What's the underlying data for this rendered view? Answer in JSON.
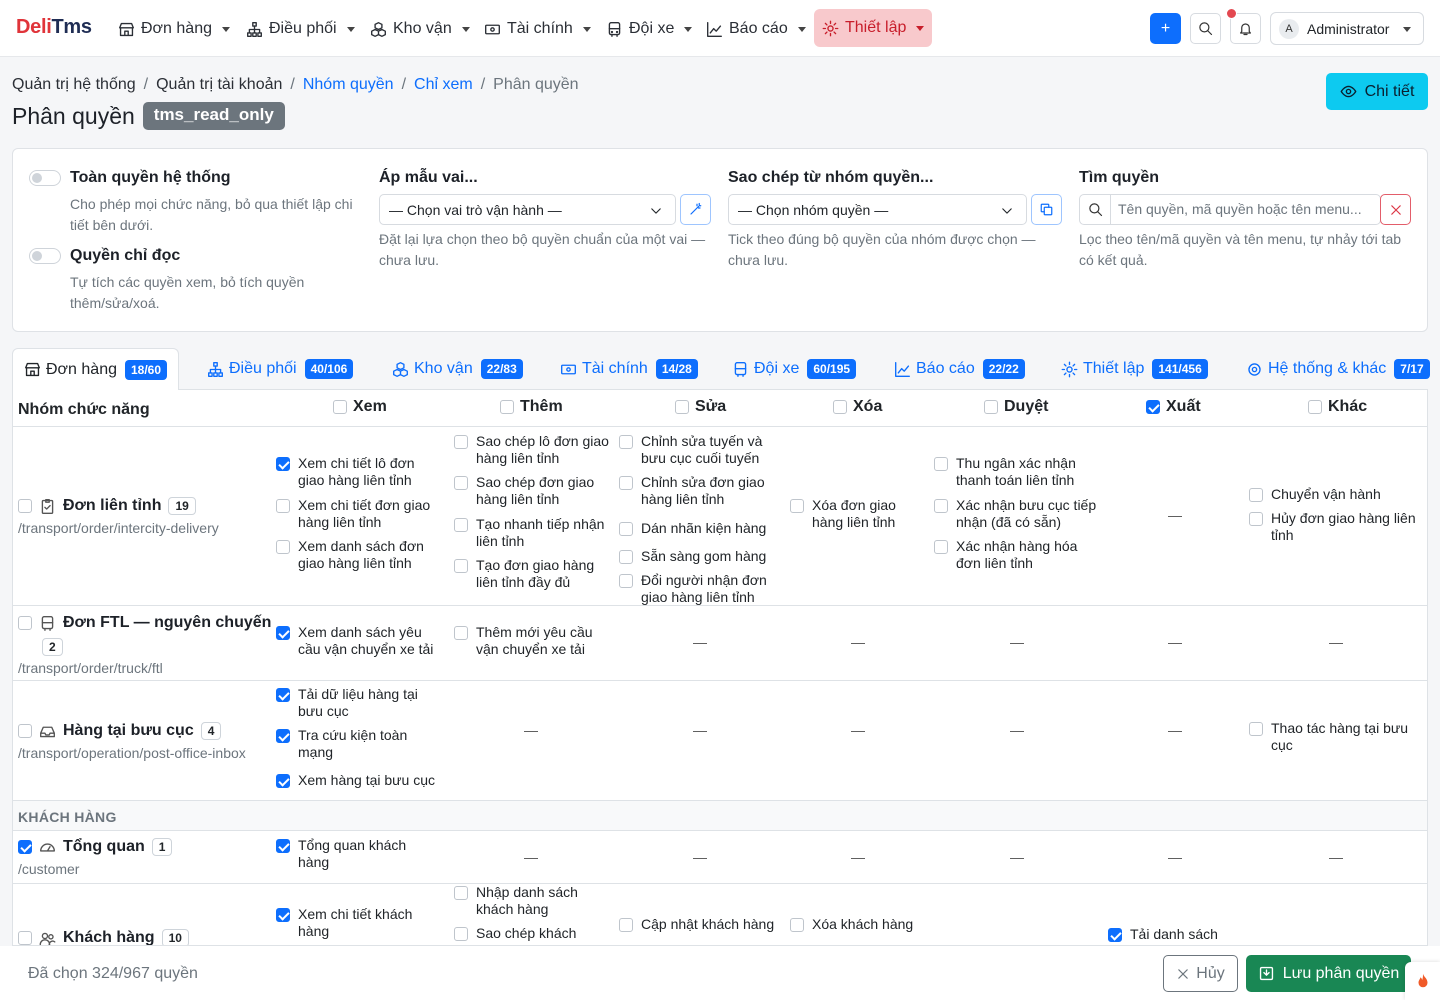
{
  "brand": {
    "part1": "Deli",
    "part2": "Tms"
  },
  "nav": [
    {
      "label": "Đơn hàng",
      "icon": "store-icon"
    },
    {
      "label": "Điều phối",
      "icon": "network-icon"
    },
    {
      "label": "Kho vận",
      "icon": "boxes-icon"
    },
    {
      "label": "Tài chính",
      "icon": "cash-icon"
    },
    {
      "label": "Đội xe",
      "icon": "bus-icon"
    },
    {
      "label": "Báo cáo",
      "icon": "chart-icon"
    },
    {
      "label": "Thiết lập",
      "icon": "gear-icon",
      "active": true
    }
  ],
  "topbar": {
    "plus_label": "+",
    "user_initial": "A",
    "user_name": "Administrator"
  },
  "breadcrumb": [
    "Quản trị hệ thống",
    "Quản trị tài khoản",
    "Nhóm quyền",
    "Chỉ xem",
    "Phân quyền"
  ],
  "page": {
    "title": "Phân quyền",
    "role_tag": "tms_read_only",
    "detail_button": "Chi tiết"
  },
  "settings": {
    "full_access": {
      "title": "Toàn quyền hệ thống",
      "help": "Cho phép mọi chức năng, bỏ qua thiết lập chi tiết bên dưới."
    },
    "read_only": {
      "title": "Quyền chỉ đọc",
      "help": "Tự tích các quyền xem, bỏ tích quyền thêm/sửa/xoá."
    },
    "apply_template": {
      "title": "Áp mẫu vai...",
      "select": "— Chọn vai trò vận hành —",
      "help": "Đặt lại lựa chọn theo bộ quyền chuẩn của một vai — chưa lưu."
    },
    "copy_group": {
      "title": "Sao chép từ nhóm quyền...",
      "select": "— Chọn nhóm quyền —",
      "help": "Tick theo đúng bộ quyền của nhóm được chọn — chưa lưu."
    },
    "search": {
      "title": "Tìm quyền",
      "placeholder": "Tên quyền, mã quyền hoặc tên menu...",
      "help": "Lọc theo tên/mã quyền và tên menu, tự nhảy tới tab có kết quả."
    }
  },
  "tabs": [
    {
      "label": "Đơn hàng",
      "badge": "18/60",
      "icon": "store-icon"
    },
    {
      "label": "Điều phối",
      "badge": "40/106",
      "icon": "network-icon"
    },
    {
      "label": "Kho vận",
      "badge": "22/83",
      "icon": "boxes-icon"
    },
    {
      "label": "Tài chính",
      "badge": "14/28",
      "icon": "cash-icon"
    },
    {
      "label": "Đội xe",
      "badge": "60/195",
      "icon": "bus-icon"
    },
    {
      "label": "Báo cáo",
      "badge": "22/22",
      "icon": "chart-icon"
    },
    {
      "label": "Thiết lập",
      "badge": "141/456",
      "icon": "gear-icon"
    },
    {
      "label": "Hệ thống & khác",
      "badge": "7/17",
      "icon": "cog-icon"
    }
  ],
  "columns": {
    "group": "Nhóm chức năng",
    "view": "Xem",
    "add": "Thêm",
    "edit": "Sửa",
    "delete": "Xóa",
    "approve": "Duyệt",
    "export": "Xuất",
    "other": "Khác"
  },
  "dash": "—",
  "rows": {
    "r1": {
      "name": "Đơn liên tỉnh",
      "count": "19",
      "path": "/transport/order/intercity-delivery",
      "view": [
        "Xem chi tiết lô đơn giao hàng liên tỉnh",
        "Xem chi tiết đơn giao hàng liên tỉnh",
        "Xem danh sách đơn giao hàng liên tỉnh"
      ],
      "add": [
        "Sao chép lô đơn giao hàng liên tỉnh",
        "Sao chép đơn giao hàng liên tỉnh",
        "Tạo nhanh tiếp nhận liên tỉnh",
        "Tạo đơn giao hàng liên tỉnh đầy đủ"
      ],
      "edit": [
        "Chỉnh sửa tuyến và bưu cục cuối tuyến",
        "Chỉnh sửa đơn giao hàng liên tỉnh",
        "Dán nhãn kiện hàng",
        "Sẵn sàng gom hàng",
        "Đổi người nhận đơn giao hàng liên tỉnh"
      ],
      "delete": [
        "Xóa đơn giao hàng liên tỉnh"
      ],
      "approve": [
        "Thu ngân xác nhận thanh toán liên tỉnh",
        "Xác nhận bưu cục tiếp nhận (đã có sẵn)",
        "Xác nhận hàng hóa đơn liên tỉnh"
      ],
      "other": [
        "Chuyển vận hành",
        "Hủy đơn giao hàng liên tỉnh"
      ]
    },
    "r2": {
      "name": "Đơn FTL — nguyên chuyến",
      "count": "2",
      "path": "/transport/order/truck/ftl",
      "view": [
        "Xem danh sách yêu cầu vận chuyển xe tải"
      ],
      "add": [
        "Thêm mới yêu cầu vận chuyển xe tải"
      ]
    },
    "r3": {
      "name": "Hàng tại bưu cục",
      "count": "4",
      "path": "/transport/operation/post-office-inbox",
      "view": [
        "Tải dữ liệu hàng tại bưu cục",
        "Tra cứu kiện toàn mạng",
        "Xem hàng tại bưu cục"
      ],
      "other": [
        "Thao tác hàng tại bưu cục"
      ]
    },
    "section": "KHÁCH HÀNG",
    "r4": {
      "name": "Tổng quan",
      "count": "1",
      "path": "/customer",
      "view": [
        "Tổng quan khách hàng"
      ]
    },
    "r5": {
      "name": "Khách hàng",
      "count": "10",
      "view": [
        "Xem chi tiết khách hàng"
      ],
      "add": [
        "Nhập danh sách khách hàng",
        "Sao chép khách"
      ],
      "edit": [
        "Cập nhật khách hàng"
      ],
      "delete": [
        "Xóa khách hàng"
      ],
      "export": [
        "Tải danh sách"
      ]
    }
  },
  "footer": {
    "selected": "Đã chọn 324/967 quyền",
    "cancel": "Hủy",
    "save": "Lưu phân quyền"
  }
}
